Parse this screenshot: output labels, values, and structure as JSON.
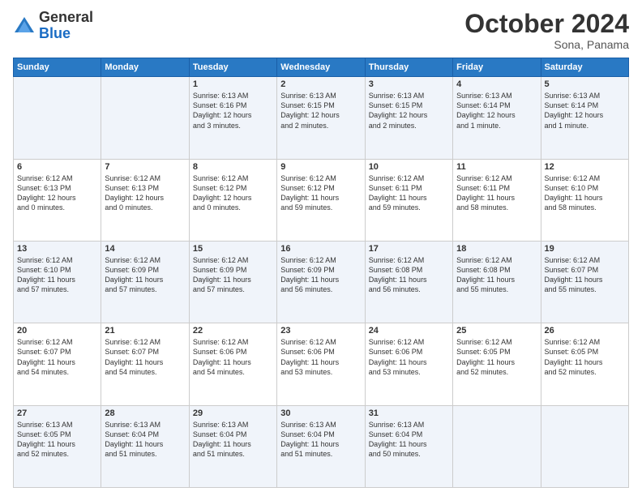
{
  "logo": {
    "general": "General",
    "blue": "Blue"
  },
  "header": {
    "month": "October 2024",
    "location": "Sona, Panama"
  },
  "weekdays": [
    "Sunday",
    "Monday",
    "Tuesday",
    "Wednesday",
    "Thursday",
    "Friday",
    "Saturday"
  ],
  "weeks": [
    [
      {
        "day": "",
        "content": ""
      },
      {
        "day": "",
        "content": ""
      },
      {
        "day": "1",
        "content": "Sunrise: 6:13 AM\nSunset: 6:16 PM\nDaylight: 12 hours\nand 3 minutes."
      },
      {
        "day": "2",
        "content": "Sunrise: 6:13 AM\nSunset: 6:15 PM\nDaylight: 12 hours\nand 2 minutes."
      },
      {
        "day": "3",
        "content": "Sunrise: 6:13 AM\nSunset: 6:15 PM\nDaylight: 12 hours\nand 2 minutes."
      },
      {
        "day": "4",
        "content": "Sunrise: 6:13 AM\nSunset: 6:14 PM\nDaylight: 12 hours\nand 1 minute."
      },
      {
        "day": "5",
        "content": "Sunrise: 6:13 AM\nSunset: 6:14 PM\nDaylight: 12 hours\nand 1 minute."
      }
    ],
    [
      {
        "day": "6",
        "content": "Sunrise: 6:12 AM\nSunset: 6:13 PM\nDaylight: 12 hours\nand 0 minutes."
      },
      {
        "day": "7",
        "content": "Sunrise: 6:12 AM\nSunset: 6:13 PM\nDaylight: 12 hours\nand 0 minutes."
      },
      {
        "day": "8",
        "content": "Sunrise: 6:12 AM\nSunset: 6:12 PM\nDaylight: 12 hours\nand 0 minutes."
      },
      {
        "day": "9",
        "content": "Sunrise: 6:12 AM\nSunset: 6:12 PM\nDaylight: 11 hours\nand 59 minutes."
      },
      {
        "day": "10",
        "content": "Sunrise: 6:12 AM\nSunset: 6:11 PM\nDaylight: 11 hours\nand 59 minutes."
      },
      {
        "day": "11",
        "content": "Sunrise: 6:12 AM\nSunset: 6:11 PM\nDaylight: 11 hours\nand 58 minutes."
      },
      {
        "day": "12",
        "content": "Sunrise: 6:12 AM\nSunset: 6:10 PM\nDaylight: 11 hours\nand 58 minutes."
      }
    ],
    [
      {
        "day": "13",
        "content": "Sunrise: 6:12 AM\nSunset: 6:10 PM\nDaylight: 11 hours\nand 57 minutes."
      },
      {
        "day": "14",
        "content": "Sunrise: 6:12 AM\nSunset: 6:09 PM\nDaylight: 11 hours\nand 57 minutes."
      },
      {
        "day": "15",
        "content": "Sunrise: 6:12 AM\nSunset: 6:09 PM\nDaylight: 11 hours\nand 57 minutes."
      },
      {
        "day": "16",
        "content": "Sunrise: 6:12 AM\nSunset: 6:09 PM\nDaylight: 11 hours\nand 56 minutes."
      },
      {
        "day": "17",
        "content": "Sunrise: 6:12 AM\nSunset: 6:08 PM\nDaylight: 11 hours\nand 56 minutes."
      },
      {
        "day": "18",
        "content": "Sunrise: 6:12 AM\nSunset: 6:08 PM\nDaylight: 11 hours\nand 55 minutes."
      },
      {
        "day": "19",
        "content": "Sunrise: 6:12 AM\nSunset: 6:07 PM\nDaylight: 11 hours\nand 55 minutes."
      }
    ],
    [
      {
        "day": "20",
        "content": "Sunrise: 6:12 AM\nSunset: 6:07 PM\nDaylight: 11 hours\nand 54 minutes."
      },
      {
        "day": "21",
        "content": "Sunrise: 6:12 AM\nSunset: 6:07 PM\nDaylight: 11 hours\nand 54 minutes."
      },
      {
        "day": "22",
        "content": "Sunrise: 6:12 AM\nSunset: 6:06 PM\nDaylight: 11 hours\nand 54 minutes."
      },
      {
        "day": "23",
        "content": "Sunrise: 6:12 AM\nSunset: 6:06 PM\nDaylight: 11 hours\nand 53 minutes."
      },
      {
        "day": "24",
        "content": "Sunrise: 6:12 AM\nSunset: 6:06 PM\nDaylight: 11 hours\nand 53 minutes."
      },
      {
        "day": "25",
        "content": "Sunrise: 6:12 AM\nSunset: 6:05 PM\nDaylight: 11 hours\nand 52 minutes."
      },
      {
        "day": "26",
        "content": "Sunrise: 6:12 AM\nSunset: 6:05 PM\nDaylight: 11 hours\nand 52 minutes."
      }
    ],
    [
      {
        "day": "27",
        "content": "Sunrise: 6:13 AM\nSunset: 6:05 PM\nDaylight: 11 hours\nand 52 minutes."
      },
      {
        "day": "28",
        "content": "Sunrise: 6:13 AM\nSunset: 6:04 PM\nDaylight: 11 hours\nand 51 minutes."
      },
      {
        "day": "29",
        "content": "Sunrise: 6:13 AM\nSunset: 6:04 PM\nDaylight: 11 hours\nand 51 minutes."
      },
      {
        "day": "30",
        "content": "Sunrise: 6:13 AM\nSunset: 6:04 PM\nDaylight: 11 hours\nand 51 minutes."
      },
      {
        "day": "31",
        "content": "Sunrise: 6:13 AM\nSunset: 6:04 PM\nDaylight: 11 hours\nand 50 minutes."
      },
      {
        "day": "",
        "content": ""
      },
      {
        "day": "",
        "content": ""
      }
    ]
  ]
}
